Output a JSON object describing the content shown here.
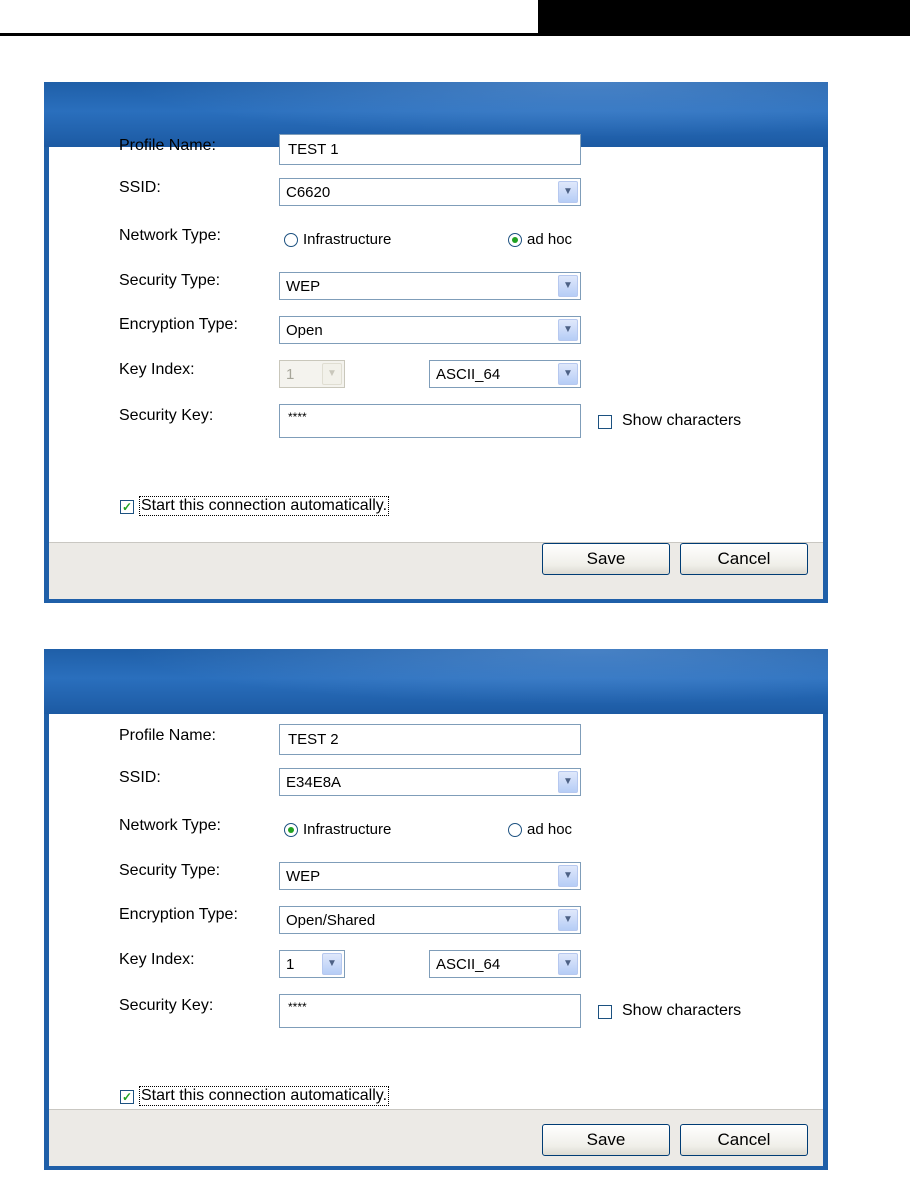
{
  "dialogs": [
    {
      "labels": {
        "profile_name": "Profile Name:",
        "ssid": "SSID:",
        "network_type": "Network Type:",
        "security_type": "Security Type:",
        "encryption_type": "Encryption Type:",
        "key_index": "Key Index:",
        "security_key": "Security Key:"
      },
      "profile_name": "TEST 1",
      "ssid": "C6620",
      "network_options": {
        "infrastructure": "Infrastructure",
        "adhoc": "ad hoc",
        "selected": "adhoc"
      },
      "security_type": "WEP",
      "encryption_type": "Open",
      "key_index": "1",
      "key_index_disabled": true,
      "key_format": "ASCII_64",
      "security_key": "****",
      "show_characters": "Show characters",
      "show_characters_checked": false,
      "auto_connect": "Start this connection automatically.",
      "auto_connect_checked": true,
      "save_label": "Save",
      "cancel_label": "Cancel"
    },
    {
      "labels": {
        "profile_name": "Profile Name:",
        "ssid": "SSID:",
        "network_type": "Network Type:",
        "security_type": "Security Type:",
        "encryption_type": "Encryption Type:",
        "key_index": "Key Index:",
        "security_key": "Security Key:"
      },
      "profile_name": "TEST 2",
      "ssid": "E34E8A",
      "network_options": {
        "infrastructure": "Infrastructure",
        "adhoc": "ad hoc",
        "selected": "infrastructure"
      },
      "security_type": "WEP",
      "encryption_type": "Open/Shared",
      "key_index": "1",
      "key_index_disabled": false,
      "key_format": "ASCII_64",
      "security_key": "****",
      "show_characters": "Show characters",
      "show_characters_checked": false,
      "auto_connect": "Start this connection automatically.",
      "auto_connect_checked": true,
      "save_label": "Save",
      "cancel_label": "Cancel"
    }
  ],
  "icons": {
    "dropdown": "chevron-down-icon",
    "checked": "checkmark-icon",
    "radio": "radio-dot-icon"
  }
}
